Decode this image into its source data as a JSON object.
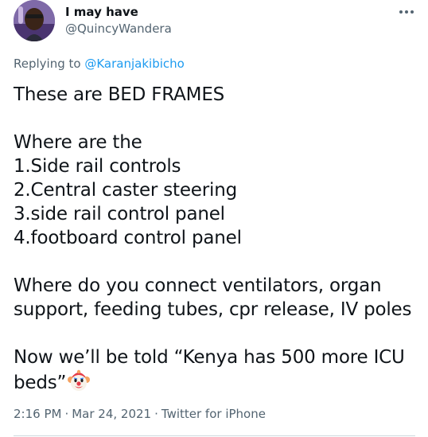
{
  "author": {
    "display_name": "I may have",
    "handle": "@QuincyWandera"
  },
  "reply": {
    "prefix": "Replying to",
    "to_handle": "@Karanjakibicho"
  },
  "body": {
    "line1": "These are BED FRAMES",
    "line2": "Where are the",
    "line3": "1.Side rail controls",
    "line4": "2.Central caster steering",
    "line5": "3.side rail control panel",
    "line6": "4.footboard control panel",
    "line7": "Where do you connect ventilators, organ",
    "line8": "support, feeding tubes, cpr release, IV poles",
    "line9": "Now we’ll be told “Kenya has 500 more ICU",
    "line10": "beds”",
    "emoji": "clown-face-icon"
  },
  "meta": {
    "time": "2:16 PM",
    "date": "Mar 24, 2021",
    "source": "Twitter for iPhone",
    "separator": "·"
  },
  "colors": {
    "text": "#0f1419",
    "secondary": "#536471",
    "link": "#1d9bf0",
    "divider": "#cfd9de"
  }
}
